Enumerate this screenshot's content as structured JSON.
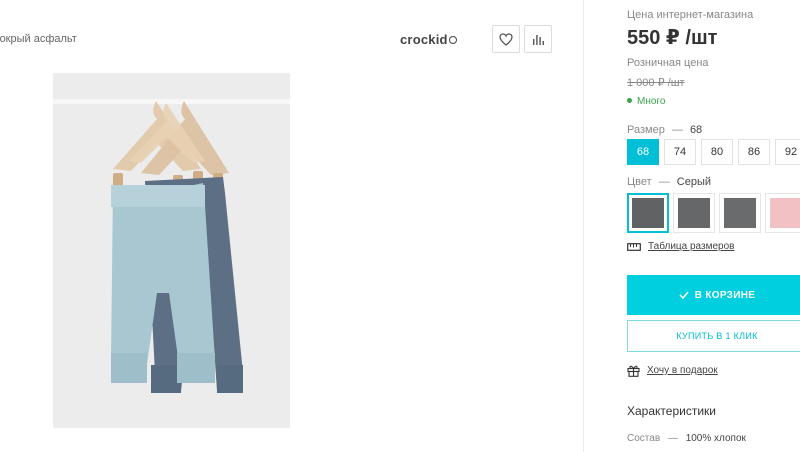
{
  "header": {
    "color_caption": "мокрый асфальт",
    "brand": "crockid",
    "favorite_icon": "heart-icon",
    "compare_icon": "bar-chart-icon"
  },
  "pricing": {
    "online_label": "Цена интернет-магазина",
    "online_price": "550 ₽ /шт",
    "retail_label": "Розничная цена",
    "retail_price": "1 000 ₽ /шт",
    "stock_status": "Много",
    "stock_color": "#3aa64a"
  },
  "size": {
    "label": "Размер",
    "separator": "—",
    "selected": "68",
    "options": [
      "68",
      "74",
      "80",
      "86",
      "92"
    ]
  },
  "color": {
    "label": "Цвет",
    "separator": "—",
    "selected": "Серый",
    "swatches": [
      "#606264",
      "#666769",
      "#6a6b6d",
      "#f1c1c3"
    ]
  },
  "size_table_link": "Таблица размеров",
  "actions": {
    "cart_label": "В КОРЗИНЕ",
    "one_click_label": "КУПИТЬ В 1 КЛИК",
    "gift_label": "Хочу в подарок"
  },
  "specs": {
    "title": "Характеристики",
    "rows": [
      {
        "key": "Состав",
        "value": "100% хлопок"
      }
    ]
  },
  "accent_color": "#00cfe0"
}
